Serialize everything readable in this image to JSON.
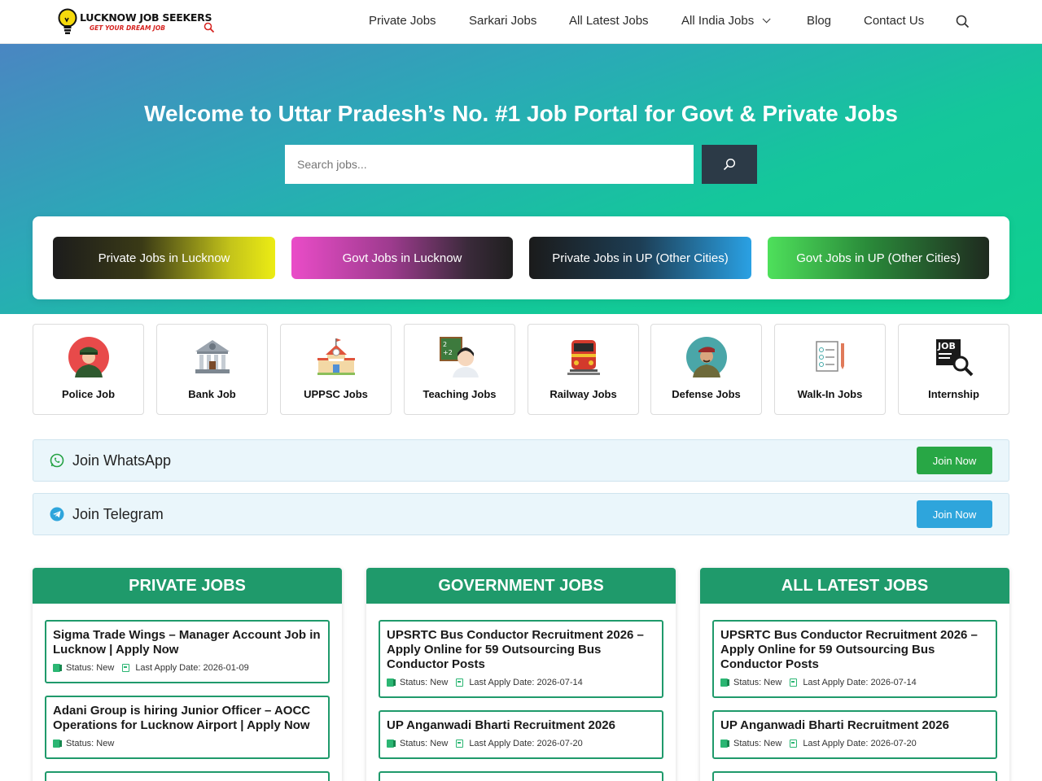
{
  "header": {
    "logo_title": "LUCKNOW JOB SEEKERS",
    "logo_tagline": "GET YOUR DREAM JOB",
    "nav": [
      {
        "label": "Private Jobs"
      },
      {
        "label": "Sarkari Jobs"
      },
      {
        "label": "All Latest Jobs"
      },
      {
        "label": "All India Jobs"
      },
      {
        "label": "Blog"
      },
      {
        "label": "Contact Us"
      }
    ]
  },
  "hero": {
    "title": "Welcome to Uttar Pradesh’s No. #1 Job Portal for Govt & Private Jobs",
    "search_placeholder": "Search jobs...",
    "quick_links": [
      {
        "label": "Private Jobs in Lucknow"
      },
      {
        "label": "Govt Jobs in Lucknow"
      },
      {
        "label": "Private Jobs in UP (Other Cities)"
      },
      {
        "label": "Govt Jobs in UP (Other Cities)"
      }
    ]
  },
  "categories": [
    {
      "label": "Police Job",
      "icon": "police-officer-icon"
    },
    {
      "label": "Bank Job",
      "icon": "bank-icon"
    },
    {
      "label": "UPPSC Jobs",
      "icon": "school-icon"
    },
    {
      "label": "Teaching Jobs",
      "icon": "teacher-icon"
    },
    {
      "label": "Railway Jobs",
      "icon": "train-icon"
    },
    {
      "label": "Defense Jobs",
      "icon": "soldier-icon"
    },
    {
      "label": "Walk-In Jobs",
      "icon": "checklist-icon"
    },
    {
      "label": "Internship",
      "icon": "job-search-icon"
    }
  ],
  "join": {
    "whatsapp": {
      "label": "Join WhatsApp",
      "button": "Join Now",
      "color": "#28a745"
    },
    "telegram": {
      "label": "Join Telegram",
      "button": "Join Now",
      "color": "#2ea5dc"
    }
  },
  "columns": [
    {
      "title": "PRIVATE JOBS",
      "jobs": [
        {
          "title": "Sigma Trade Wings – Manager Account Job in Lucknow | Apply Now",
          "status": "Status: New",
          "last_date": "Last Apply Date: 2026-01-09"
        },
        {
          "title": "Adani Group is hiring Junior Officer – AOCC Operations for Lucknow Airport | Apply Now",
          "status": "Status: New",
          "last_date": ""
        }
      ]
    },
    {
      "title": "GOVERNMENT JOBS",
      "jobs": [
        {
          "title": "UPSRTC Bus Conductor Recruitment 2026 – Apply Online for 59 Outsourcing Bus Conductor Posts",
          "status": "Status: New",
          "last_date": "Last Apply Date: 2026-07-14"
        },
        {
          "title": "UP Anganwadi Bharti Recruitment 2026",
          "status": "Status: New",
          "last_date": "Last Apply Date: 2026-07-20"
        }
      ]
    },
    {
      "title": "ALL LATEST JOBS",
      "jobs": [
        {
          "title": "UPSRTC Bus Conductor Recruitment 2026 – Apply Online for 59 Outsourcing Bus Conductor Posts",
          "status": "Status: New",
          "last_date": "Last Apply Date: 2026-07-14"
        },
        {
          "title": "UP Anganwadi Bharti Recruitment 2026",
          "status": "Status: New",
          "last_date": "Last Apply Date: 2026-07-20"
        }
      ]
    }
  ],
  "colors": {
    "brand_green": "#1f9a6b",
    "hero_start": "#4a86c2",
    "hero_end": "#0fd08e",
    "search_button": "#2c3a47"
  }
}
